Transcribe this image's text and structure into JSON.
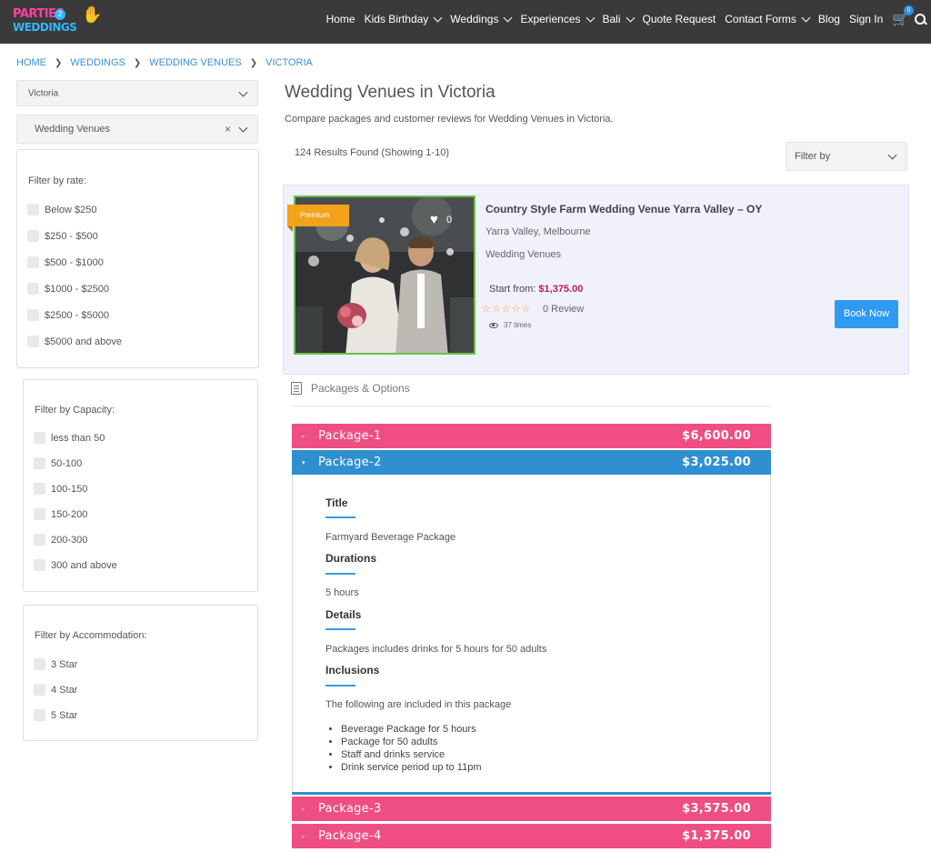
{
  "brand": {
    "line1": "PARTIES",
    "badge": "2",
    "line2": "WEDDINGS"
  },
  "nav": {
    "items": [
      {
        "label": "Home",
        "dropdown": false
      },
      {
        "label": "Kids Birthday",
        "dropdown": true
      },
      {
        "label": "Weddings",
        "dropdown": true
      },
      {
        "label": "Experiences",
        "dropdown": true
      },
      {
        "label": "Bali",
        "dropdown": true
      },
      {
        "label": "Quote Request",
        "dropdown": false
      },
      {
        "label": "Contact Forms",
        "dropdown": true
      },
      {
        "label": "Blog",
        "dropdown": false
      },
      {
        "label": "Sign In",
        "dropdown": false
      }
    ],
    "cart_count": "0",
    "cart_icon": "cart-icon",
    "search_icon": "search-icon"
  },
  "breadcrumb": [
    "HOME",
    "WEDDINGS",
    "WEDDING VENUES",
    "VICTORIA"
  ],
  "filters": {
    "location_select": "Victoria",
    "category_select": "Wedding Venues",
    "rate": {
      "title": "Filter by rate:",
      "options": [
        "Below $250",
        "$250 - $500",
        "$500 - $1000",
        "$1000 - $2500",
        "$2500 - $5000",
        "$5000 and above"
      ]
    },
    "capacity": {
      "title": "Filter by Capacity:",
      "options": [
        "less than 50",
        "50-100",
        "100-150",
        "150-200",
        "200-300",
        "300 and above"
      ]
    },
    "accommodation": {
      "title": "Filter by Accommodation:",
      "options": [
        "3 Star",
        "4 Star",
        "5 Star"
      ]
    }
  },
  "main": {
    "title": "Wedding Venues in Victoria",
    "subtitle": "Compare packages and customer reviews for Wedding Venues in Victoria.",
    "results": "124 Results Found (Showing 1-10)",
    "filter_by": "Filter by"
  },
  "listing": {
    "badge": "Premium",
    "favorites": "0",
    "title": "Country Style Farm Wedding Venue Yarra Valley – OY",
    "location": "Yarra Valley, Melbourne",
    "category": "Wedding Venues",
    "start_label": "Start from: ",
    "start_price": "$1,375.00",
    "stars": "☆☆☆☆☆",
    "reviews": "0 Review",
    "views": "37 times",
    "book_label": "Book Now",
    "accent_colors": {
      "badge": "#f5a21b",
      "price": "#c2185b",
      "button": "#2e9bf0"
    }
  },
  "packages_header": "Packages & Options",
  "packages": [
    {
      "name": "Package-1",
      "price": "$6,600.00",
      "expanded": false
    },
    {
      "name": "Package-2",
      "price": "$3,025.00",
      "expanded": true
    },
    {
      "name": "Package-3",
      "price": "$3,575.00",
      "expanded": false
    },
    {
      "name": "Package-4",
      "price": "$1,375.00",
      "expanded": false
    }
  ],
  "package_detail": {
    "title_label": "Title",
    "title_value": "Farmyard Beverage Package",
    "durations_label": "Durations",
    "durations_value": "5 hours",
    "details_label": "Details",
    "details_value": "Packages includes drinks for 5 hours for 50 adults",
    "inclusions_label": "Inclusions",
    "inclusions_value": "The following are included in this package",
    "inclusions": [
      "Beverage Package for 5 hours",
      "Package for 50 adults",
      "Staff and drinks service",
      "Drink service period up to 11pm"
    ]
  },
  "colors": {
    "pink": "#ef4e83",
    "blue": "#2f8fd0",
    "topbar": "#3a3a3a",
    "link": "#3a8ed8"
  }
}
